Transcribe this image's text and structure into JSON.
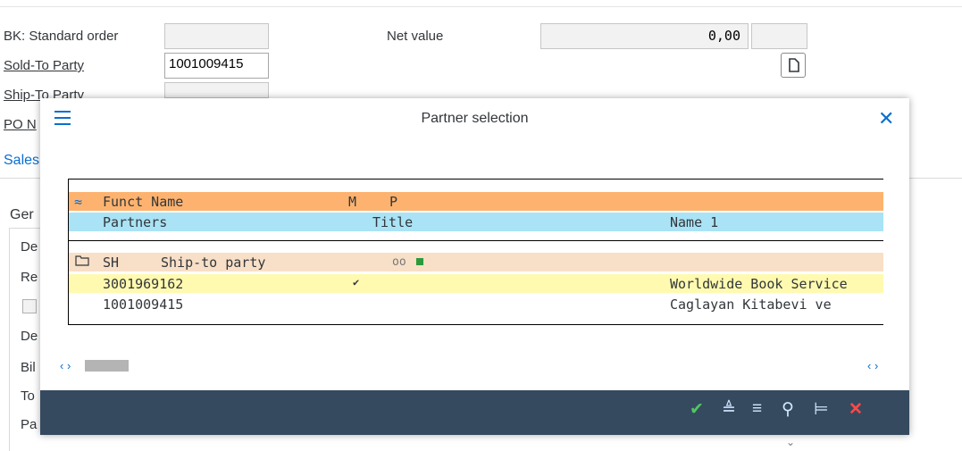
{
  "form": {
    "order_type_label": "BK: Standard order",
    "net_value_label": "Net value",
    "net_value": "0,00",
    "sold_to_label": "Sold-To Party",
    "sold_to_value": "1001009415",
    "ship_to_label": "Ship-To Party",
    "po_label": "PO N",
    "sales_tab": "Sales",
    "general_label": "Ger",
    "left_rows": [
      "De",
      "Re",
      "De",
      "Bil",
      "To",
      "Pa"
    ]
  },
  "dialog": {
    "title": "Partner selection",
    "header1": {
      "col1": "Funct Name",
      "col2": "M",
      "col3": "P"
    },
    "header2": {
      "col1": "Partners",
      "col2": "Title",
      "col3": "Name 1"
    },
    "group": {
      "code": "SH",
      "name": "Ship-to party",
      "indicator": "oo"
    },
    "rows": [
      {
        "partner": "3001969162",
        "mark": "✔",
        "name": "Worldwide Book Service"
      },
      {
        "partner": "1001009415",
        "mark": "",
        "name": "Caglayan Kitabevi ve"
      }
    ]
  },
  "footer_icons": [
    "check-icon",
    "sort-ascending-icon",
    "filter-icon",
    "search-icon",
    "sort-descending-icon",
    "cancel-icon"
  ],
  "colors": {
    "header1": "#fdb36f",
    "header2": "#a9e3f5",
    "group": "#f8dfc7",
    "selected": "#fffab0",
    "footer": "#354a5f",
    "accent": "#0a6ed1"
  }
}
